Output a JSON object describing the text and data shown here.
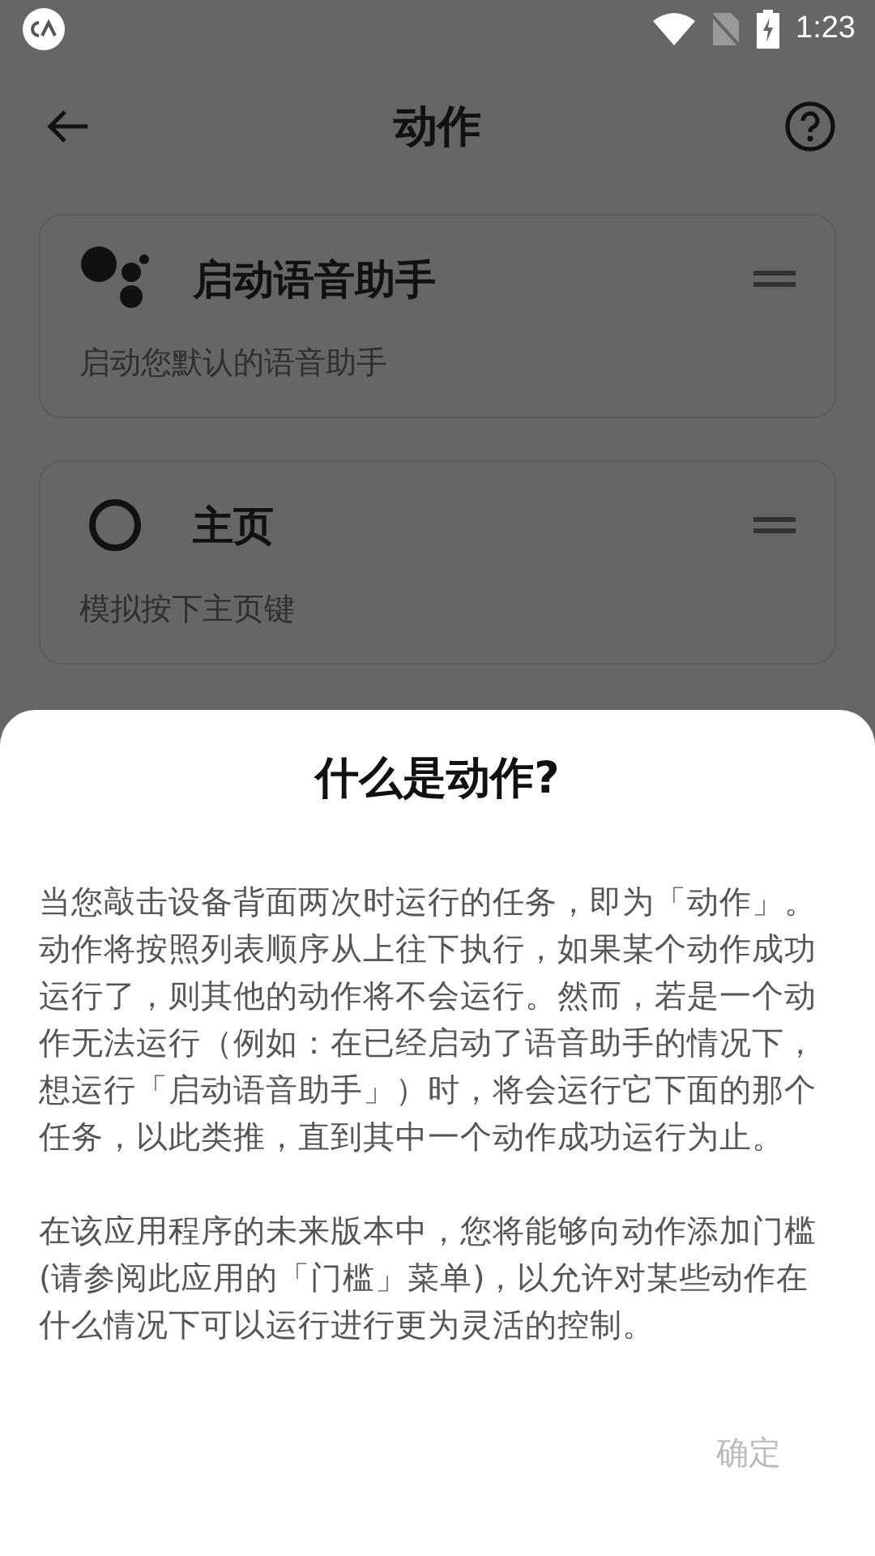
{
  "status_bar": {
    "time": "1:23"
  },
  "app_bar": {
    "title": "动作"
  },
  "actions": [
    {
      "kind": "assistant",
      "title": "启动语音助手",
      "description": "启动您默认的语音助手"
    },
    {
      "kind": "home",
      "title": "主页",
      "description": "模拟按下主页键"
    }
  ],
  "dialog": {
    "title": "什么是动作?",
    "paragraphs": [
      "当您敲击设备背面两次时运行的任务，即为「动作」。动作将按照列表顺序从上往下执行，如果某个动作成功运行了，则其他的动作将不会运行。然而，若是一个动作无法运行（例如：在已经启动了语音助手的情况下，想运行「启动语音助手」）时，将会运行它下面的那个任务，以此类推，直到其中一个动作成功运行为止。",
      "在该应用程序的未来版本中，您将能够向动作添加门槛(请参阅此应用的「门槛」菜单)，以允许对某些动作在什么情况下可以运行进行更为灵活的控制。"
    ],
    "button": "确定"
  }
}
